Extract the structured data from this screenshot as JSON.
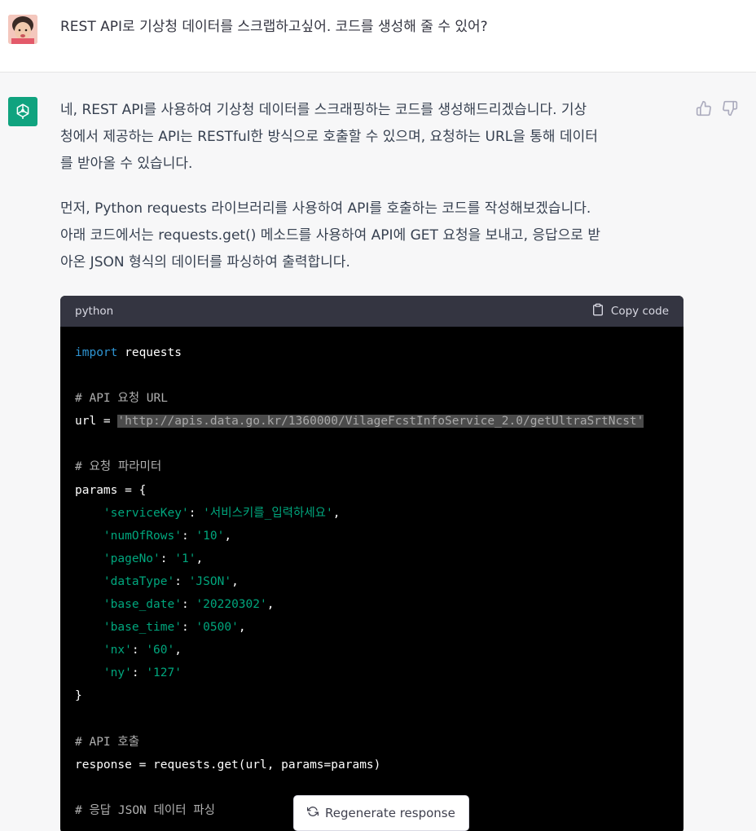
{
  "user": {
    "message": "REST API로 기상청 데이터를 스크랩하고싶어. 코드를 생성해 줄 수 있어?",
    "avatar_icon": "user-photo"
  },
  "assistant": {
    "avatar_icon": "openai-logo-icon",
    "paragraph1_line1": "네, REST API를 사용하여 기상청 데이터를 스크래핑하는 코드를 생성해드리겠습니다. 기상",
    "paragraph1_line2": "청에서 제공하는 API는 RESTful한 방식으로 호출할 수 있으며, 요청하는 URL을 통해 데이터",
    "paragraph1_line3": "를 받아올 수 있습니다.",
    "paragraph2_line1": "먼저, Python requests 라이브러리를 사용하여 API를 호출하는 코드를 작성해보겠습니다.",
    "paragraph2_line2": "아래 코드에서는 requests.get() 메소드를 사용하여 API에 GET 요청을 보내고, 응답으로 받",
    "paragraph2_line3": "아온 JSON 형식의 데이터를 파싱하여 출력합니다."
  },
  "code": {
    "language": "python",
    "copy_label": "Copy code",
    "import_kw": "import",
    "import_mod": " requests",
    "comment_url": "# API 요청 URL",
    "url_prefix": "url = ",
    "url_value": "'http://apis.data.go.kr/1360000/VilageFcstInfoService_2.0/getUltraSrtNcst'",
    "comment_params": "# 요청 파라미터",
    "params_open": "params = {",
    "param_lines": [
      {
        "key": "'serviceKey'",
        "val": "'서비스키를_입력하세요'",
        "end": ","
      },
      {
        "key": "'numOfRows'",
        "val": "'10'",
        "end": ","
      },
      {
        "key": "'pageNo'",
        "val": "'1'",
        "end": ","
      },
      {
        "key": "'dataType'",
        "val": "'JSON'",
        "end": ","
      },
      {
        "key": "'base_date'",
        "val": "'20220302'",
        "end": ","
      },
      {
        "key": "'base_time'",
        "val": "'0500'",
        "end": ","
      },
      {
        "key": "'nx'",
        "val": "'60'",
        "end": ","
      },
      {
        "key": "'ny'",
        "val": "'127'",
        "end": ""
      }
    ],
    "params_close": "}",
    "comment_call": "# API 호출",
    "call_line": "response = requests.get(url, params=params)",
    "comment_parse": "# 응답 JSON 데이터 파싱"
  },
  "regenerate_label": "Regenerate response",
  "colors": {
    "accent": "#10a37f",
    "code_bg": "#000000",
    "code_header_bg": "#343541",
    "keyword": "#2e95d3",
    "string": "#00a67d"
  }
}
